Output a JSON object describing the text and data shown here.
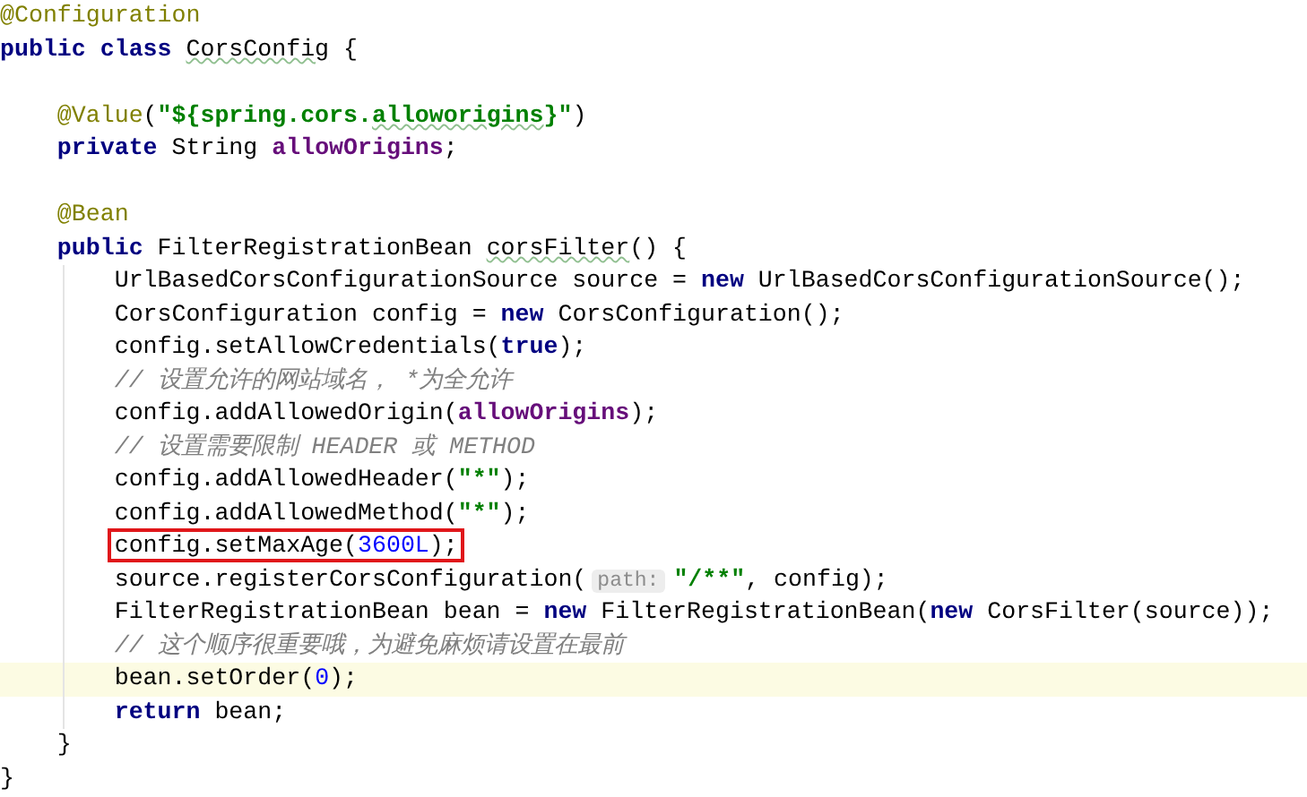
{
  "editor": {
    "lines": [
      {
        "kind": "code",
        "tokens": [
          {
            "text": "@Configuration",
            "kind": "annotation"
          }
        ]
      },
      {
        "kind": "code",
        "tokens": [
          {
            "text": "public class ",
            "kind": "keyword"
          },
          {
            "text": "CorsConfig",
            "kind": "plain",
            "spellcheck_flag": true
          },
          {
            "text": " {",
            "kind": "plain"
          }
        ]
      },
      {
        "kind": "blank"
      },
      {
        "kind": "code",
        "tokens": [
          {
            "text": "    @Value",
            "kind": "annotation"
          },
          {
            "text": "(",
            "kind": "plain"
          },
          {
            "text": "\"${spring.cors.",
            "kind": "string"
          },
          {
            "text": "alloworigins",
            "kind": "string",
            "spellcheck_flag": true
          },
          {
            "text": "}\"",
            "kind": "string"
          },
          {
            "text": ")",
            "kind": "plain"
          }
        ]
      },
      {
        "kind": "code",
        "tokens": [
          {
            "text": "    private",
            "kind": "keyword"
          },
          {
            "text": " String ",
            "kind": "plain"
          },
          {
            "text": "allowOrigins",
            "kind": "field"
          },
          {
            "text": ";",
            "kind": "plain"
          }
        ]
      },
      {
        "kind": "blank"
      },
      {
        "kind": "code",
        "tokens": [
          {
            "text": "    @Bean",
            "kind": "annotation"
          }
        ]
      },
      {
        "kind": "code",
        "tokens": [
          {
            "text": "    public",
            "kind": "keyword"
          },
          {
            "text": " FilterRegistrationBean ",
            "kind": "plain"
          },
          {
            "text": "corsFilter",
            "kind": "plain",
            "spellcheck_flag": true
          },
          {
            "text": "() {",
            "kind": "plain"
          }
        ]
      },
      {
        "kind": "code",
        "tokens": [
          {
            "text": "        UrlBasedCorsConfigurationSource source = ",
            "kind": "plain"
          },
          {
            "text": "new",
            "kind": "keyword"
          },
          {
            "text": " UrlBasedCorsConfigurationSource();",
            "kind": "plain"
          }
        ]
      },
      {
        "kind": "code",
        "tokens": [
          {
            "text": "        CorsConfiguration config = ",
            "kind": "plain"
          },
          {
            "text": "new",
            "kind": "keyword"
          },
          {
            "text": " CorsConfiguration();",
            "kind": "plain"
          }
        ]
      },
      {
        "kind": "code",
        "tokens": [
          {
            "text": "        config.setAllowCredentials(",
            "kind": "plain"
          },
          {
            "text": "true",
            "kind": "keyword"
          },
          {
            "text": ");",
            "kind": "plain"
          }
        ]
      },
      {
        "kind": "code",
        "tokens": [
          {
            "text": "        // 设置允许的网站域名， *为全允许",
            "kind": "comment"
          }
        ]
      },
      {
        "kind": "code",
        "tokens": [
          {
            "text": "        config.addAllowedOrigin(",
            "kind": "plain"
          },
          {
            "text": "allowOrigins",
            "kind": "field"
          },
          {
            "text": ");",
            "kind": "plain"
          }
        ]
      },
      {
        "kind": "code",
        "tokens": [
          {
            "text": "        // 设置需要限制 HEADER 或 METHOD",
            "kind": "comment"
          }
        ]
      },
      {
        "kind": "code",
        "tokens": [
          {
            "text": "        config.addAllowedHeader(",
            "kind": "plain"
          },
          {
            "text": "\"*\"",
            "kind": "string"
          },
          {
            "text": ");",
            "kind": "plain"
          }
        ]
      },
      {
        "kind": "code",
        "tokens": [
          {
            "text": "        config.addAllowedMethod(",
            "kind": "plain"
          },
          {
            "text": "\"*\"",
            "kind": "string"
          },
          {
            "text": ");",
            "kind": "plain"
          }
        ]
      },
      {
        "kind": "code",
        "boxed": true,
        "tokens": [
          {
            "text": "        config.setMaxAge(",
            "kind": "plain"
          },
          {
            "text": "3600L",
            "kind": "number"
          },
          {
            "text": ");",
            "kind": "plain"
          }
        ]
      },
      {
        "kind": "code",
        "tokens": [
          {
            "text": "        source.registerCorsConfiguration(",
            "kind": "plain"
          },
          {
            "text": "path:",
            "kind": "hint"
          },
          {
            "text": "\"/**\"",
            "kind": "string"
          },
          {
            "text": ", config);",
            "kind": "plain"
          }
        ]
      },
      {
        "kind": "code",
        "tokens": [
          {
            "text": "        FilterRegistrationBean bean = ",
            "kind": "plain"
          },
          {
            "text": "new",
            "kind": "keyword"
          },
          {
            "text": " FilterRegistrationBean(",
            "kind": "plain"
          },
          {
            "text": "new",
            "kind": "keyword"
          },
          {
            "text": " CorsFilter(source));",
            "kind": "plain"
          }
        ]
      },
      {
        "kind": "code",
        "tokens": [
          {
            "text": "        // 这个顺序很重要哦，为避免麻烦请设置在最前",
            "kind": "comment"
          }
        ]
      },
      {
        "kind": "code",
        "current": true,
        "tokens": [
          {
            "text": "        bean.setOrder(",
            "kind": "plain"
          },
          {
            "text": "0",
            "kind": "number"
          },
          {
            "text": ");",
            "kind": "plain"
          }
        ]
      },
      {
        "kind": "code",
        "tokens": [
          {
            "text": "        return",
            "kind": "keyword"
          },
          {
            "text": " bean;",
            "kind": "plain"
          }
        ]
      },
      {
        "kind": "code",
        "tokens": [
          {
            "text": "    }",
            "kind": "plain"
          }
        ]
      },
      {
        "kind": "code",
        "tokens": [
          {
            "text": "}",
            "kind": "plain"
          }
        ]
      }
    ]
  }
}
